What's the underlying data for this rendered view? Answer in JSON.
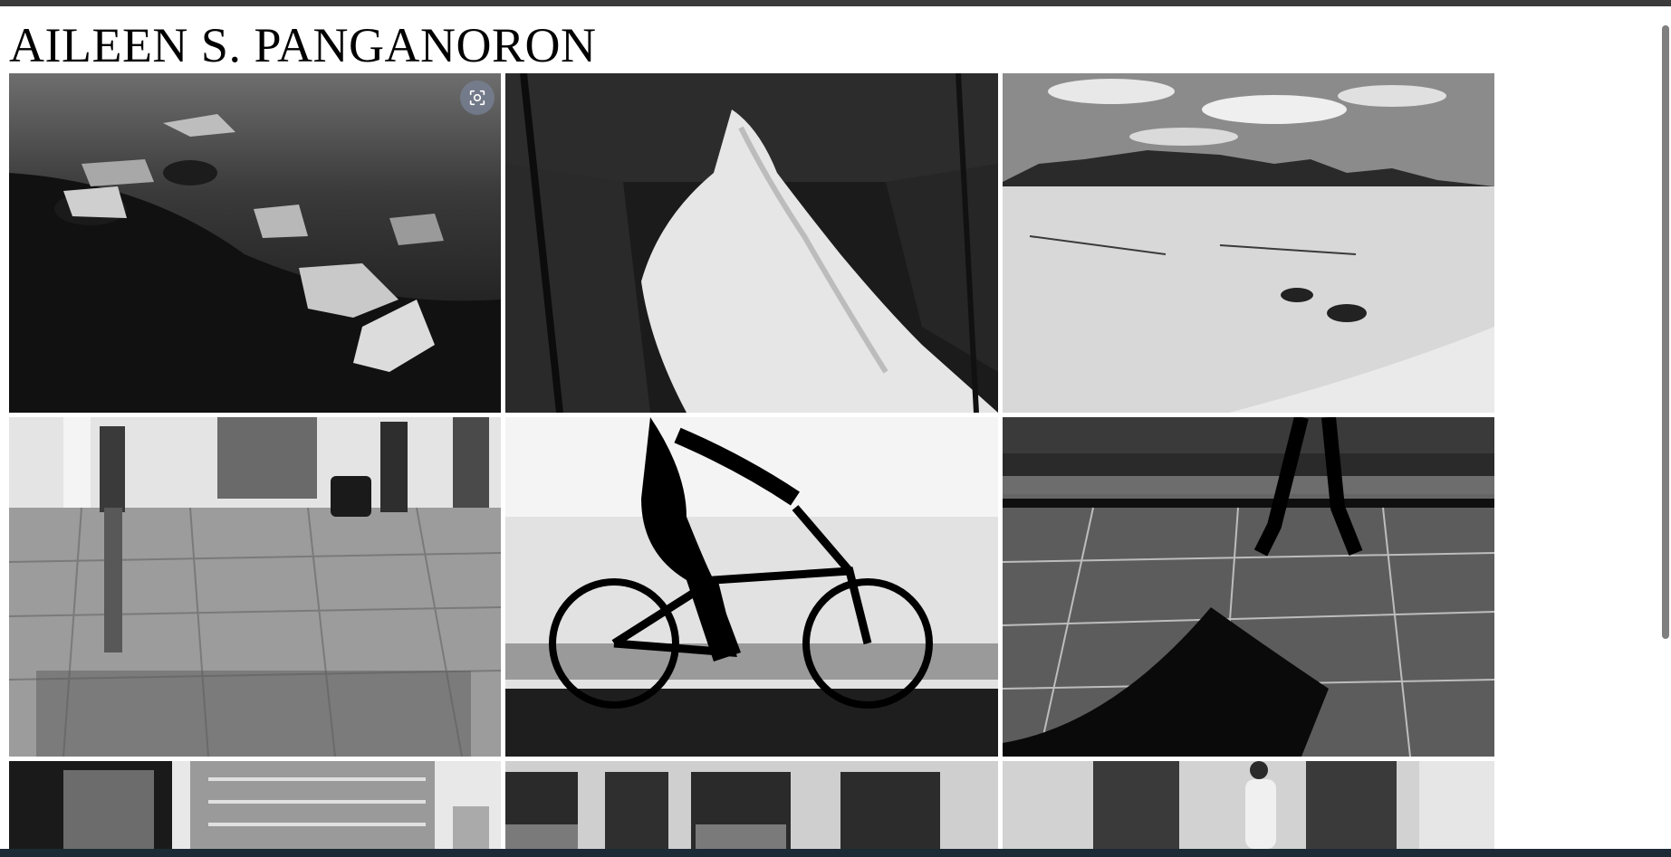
{
  "page": {
    "title": "AILEEN S. PANGANORON"
  },
  "gallery": {
    "photos": [
      {
        "subject": "ice-chunks-on-black-rock-shore"
      },
      {
        "subject": "forest-waterfall-long-exposure"
      },
      {
        "subject": "desert-dunes-with-mountains"
      },
      {
        "subject": "travelers-with-luggage-on-reflective-floor"
      },
      {
        "subject": "cyclist-silhouette"
      },
      {
        "subject": "walker-shadow-on-wet-pavement"
      },
      {
        "subject": "chair-and-buildings"
      },
      {
        "subject": "storefront-doors"
      },
      {
        "subject": "man-walking-past-windows"
      }
    ]
  },
  "overlay": {
    "lens_icon": "visual-search-icon"
  }
}
